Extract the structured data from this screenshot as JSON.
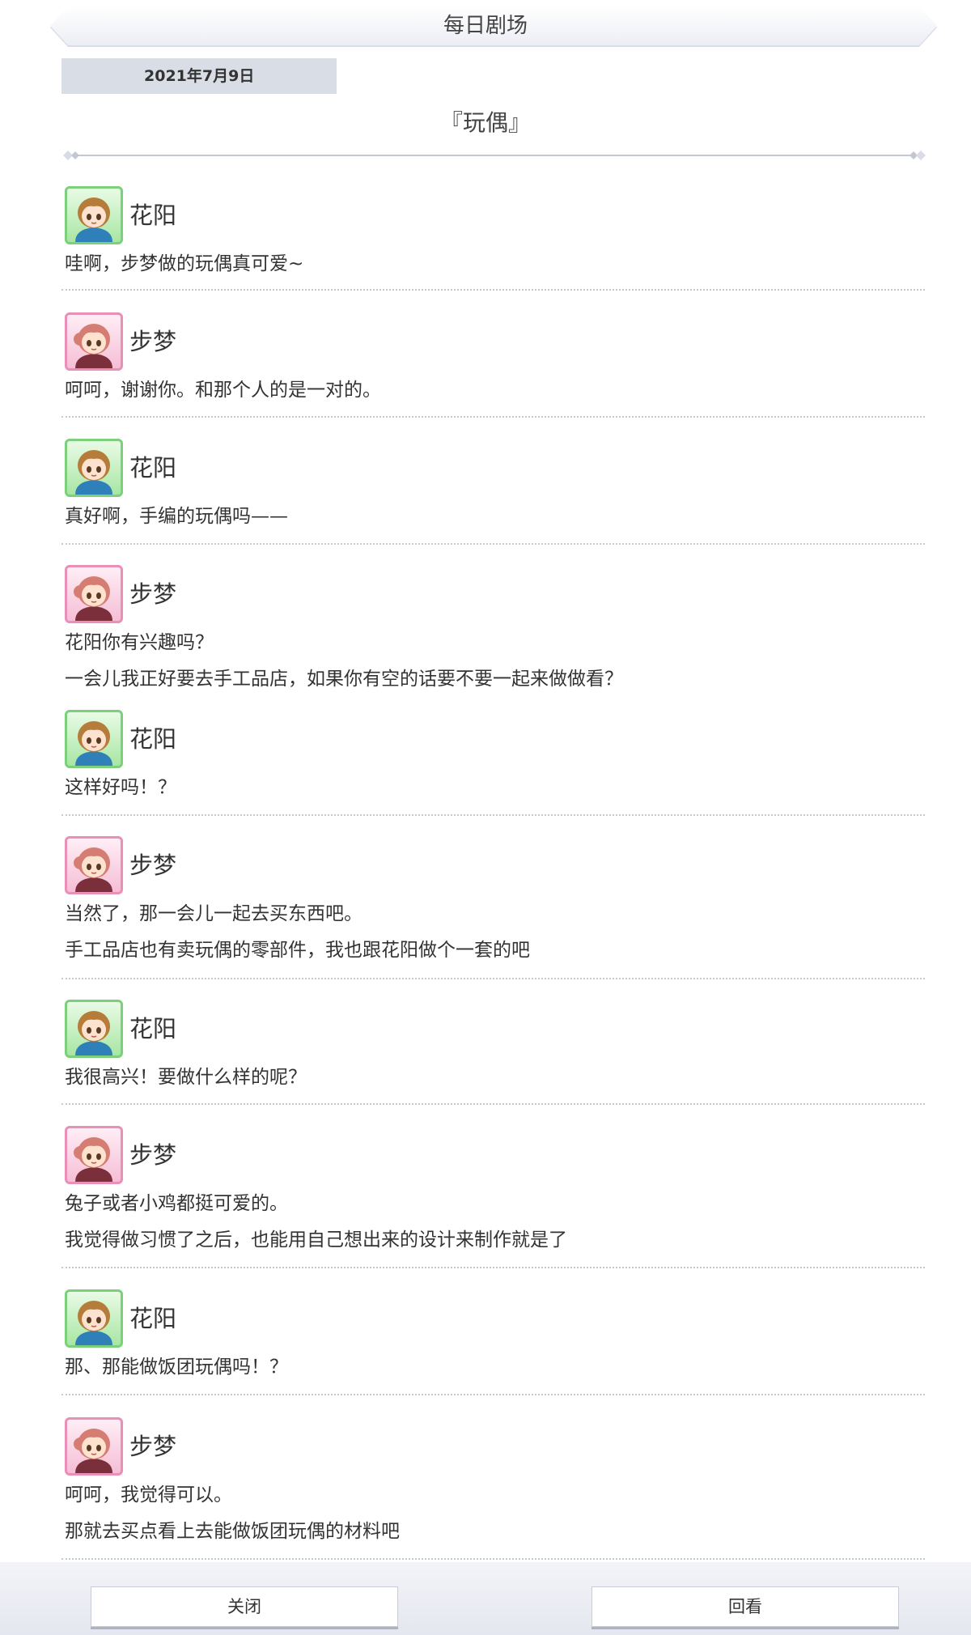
{
  "header": {
    "title": "每日剧场"
  },
  "date": "2021年7月9日",
  "story_title": "『玩偶』",
  "characters": {
    "hanayo": {
      "name": "花阳",
      "avatar_color": "#7cd07c"
    },
    "ayumu": {
      "name": "步梦",
      "avatar_color": "#ea8fb8"
    }
  },
  "dialogue": [
    {
      "speaker": "花阳",
      "lines": [
        "哇啊，步梦做的玩偶真可爱~"
      ]
    },
    {
      "speaker": "步梦",
      "lines": [
        "呵呵，谢谢你。和那个人的是一对的。"
      ]
    },
    {
      "speaker": "花阳",
      "lines": [
        "真好啊，手编的玩偶吗——"
      ]
    },
    {
      "speaker": "步梦",
      "lines": [
        "花阳你有兴趣吗？",
        "一会儿我正好要去手工品店，如果你有空的话要不要一起来做做看？"
      ]
    },
    {
      "speaker": "花阳",
      "lines": [
        "这样好吗！？"
      ]
    },
    {
      "speaker": "步梦",
      "lines": [
        "当然了，那一会儿一起去买东西吧。",
        "手工品店也有卖玩偶的零部件，我也跟花阳做个一套的吧"
      ]
    },
    {
      "speaker": "花阳",
      "lines": [
        "我很高兴！要做什么样的呢？"
      ]
    },
    {
      "speaker": "步梦",
      "lines": [
        "兔子或者小鸡都挺可爱的。",
        "我觉得做习惯了之后，也能用自己想出来的设计来制作就是了"
      ]
    },
    {
      "speaker": "花阳",
      "lines": [
        "那、那能做饭团玩偶吗！？"
      ]
    },
    {
      "speaker": "步梦",
      "lines": [
        "呵呵，我觉得可以。",
        "那就去买点看上去能做饭团玩偶的材料吧"
      ]
    }
  ],
  "buttons": {
    "close": "关闭",
    "replay": "回看"
  }
}
